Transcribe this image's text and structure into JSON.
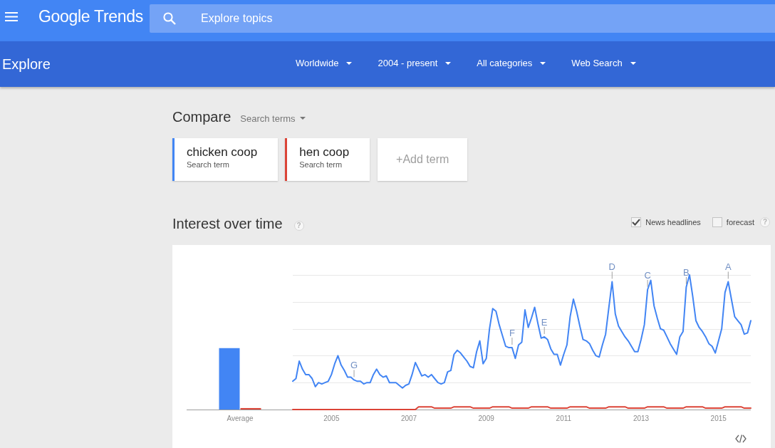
{
  "header": {
    "logo": "Google Trends",
    "search": {
      "placeholder": "Explore topics"
    }
  },
  "toolbar": {
    "title": "Explore",
    "filters": [
      {
        "label": "Worldwide"
      },
      {
        "label": "2004 - present"
      },
      {
        "label": "All categories"
      },
      {
        "label": "Web Search"
      }
    ]
  },
  "compare": {
    "title": "Compare",
    "scope_dropdown": "Search terms",
    "terms": [
      {
        "name": "chicken coop",
        "label": "Search term",
        "color": "#4285f4"
      },
      {
        "name": "hen coop",
        "label": "Search term",
        "color": "#db4437"
      }
    ],
    "add_term": "+Add term"
  },
  "interest_over_time": {
    "title": "Interest over time",
    "help": "?",
    "options": [
      {
        "label": "News headlines",
        "checked": true
      },
      {
        "label": "forecast",
        "checked": false
      }
    ],
    "options_help": "?",
    "average_label": "Average",
    "timeline": {
      "year_labels": [
        "2005",
        "2007",
        "2009",
        "2011",
        "2013",
        "2015"
      ],
      "news_markers": [
        "G",
        "F",
        "E",
        "D",
        "C",
        "B",
        "A"
      ]
    }
  }
}
